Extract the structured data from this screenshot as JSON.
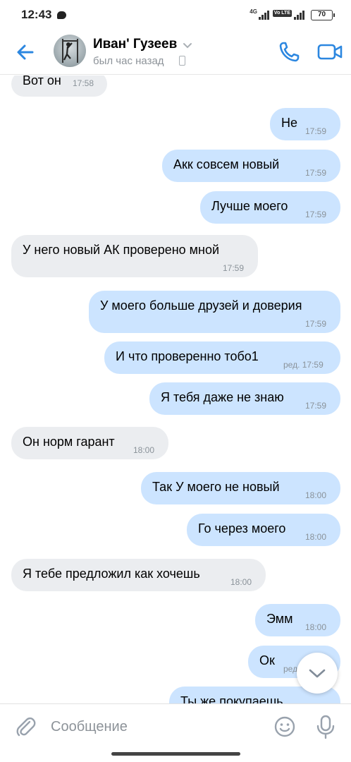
{
  "status_bar": {
    "time": "12:43",
    "network_label": "4G",
    "lte_label": "Vo LTE",
    "battery": "70",
    "icons": [
      "chat-notification-icon",
      "signal-icon",
      "battery-icon"
    ]
  },
  "header": {
    "contact_name": "Иван' Гузеев",
    "last_seen": "был час назад",
    "icons": [
      "back-arrow-icon",
      "chevron-down-icon",
      "mobile-device-icon",
      "phone-icon",
      "video-camera-icon"
    ]
  },
  "messages": [
    {
      "dir": "in",
      "text": "Вот он",
      "time": "17:58"
    },
    {
      "dir": "out",
      "text": "Не",
      "time": "17:59"
    },
    {
      "dir": "out",
      "text": "Акк совсем новый",
      "time": "17:59"
    },
    {
      "dir": "out",
      "text": "Лучше моего",
      "time": "17:59"
    },
    {
      "dir": "in",
      "text": "У него новый АК проверено мной",
      "time": "17:59"
    },
    {
      "dir": "out",
      "text": "У моего больше друзей и доверия",
      "time": "17:59"
    },
    {
      "dir": "out",
      "text": "И что проверенно тобо1",
      "time": "ред. 17:59"
    },
    {
      "dir": "out",
      "text": "Я тебя даже не знаю",
      "time": "17:59"
    },
    {
      "dir": "in",
      "text": "Он норм гарант",
      "time": "18:00"
    },
    {
      "dir": "out",
      "text": "Так У моего не новый",
      "time": "18:00"
    },
    {
      "dir": "out",
      "text": "Го через моего",
      "time": "18:00"
    },
    {
      "dir": "in",
      "text": "Я тебе предложил как хочешь",
      "time": "18:00"
    },
    {
      "dir": "out",
      "text": "Эмм",
      "time": "18:00"
    },
    {
      "dir": "out",
      "text": "Ок",
      "time": "ред"
    },
    {
      "dir": "out",
      "text": "Ты же покупаешь",
      "time": ""
    }
  ],
  "composer": {
    "placeholder": "Сообщение",
    "icons": [
      "paperclip-icon",
      "emoji-icon",
      "microphone-icon",
      "chevron-down-icon"
    ]
  },
  "colors": {
    "accent": "#2c87e0",
    "outgoing_bubble": "#cce4ff",
    "incoming_bubble": "#ebedf0",
    "secondary_text": "#8d9399"
  }
}
